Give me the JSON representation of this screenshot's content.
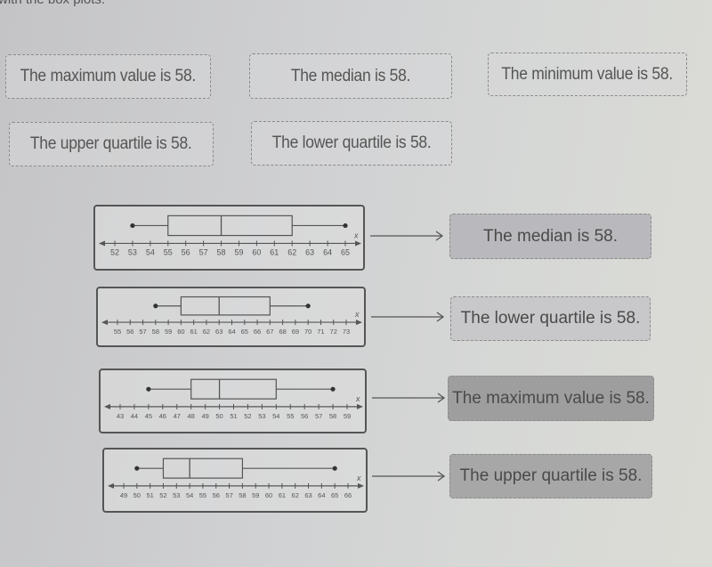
{
  "instruction": "with the box plots.",
  "tiles": [
    {
      "label": "The maximum value is 58."
    },
    {
      "label": "The median is 58."
    },
    {
      "label": "The minimum value is 58."
    },
    {
      "label": "The upper quartile is 58."
    },
    {
      "label": "The lower quartile is 58."
    }
  ],
  "pairs": [
    {
      "answer": "The median is 58.",
      "answer_bg": "#b9b9bd"
    },
    {
      "answer": "The lower quartile is 58.",
      "answer_bg": "#c8c8ca"
    },
    {
      "answer": "The maximum value is 58.",
      "answer_bg": "#9e9e9f"
    },
    {
      "answer": "The upper quartile is 58.",
      "answer_bg": "#a7a7a8"
    }
  ],
  "chart_data": [
    {
      "type": "box",
      "axis_label": "x",
      "ticks": [
        52,
        53,
        54,
        55,
        56,
        57,
        58,
        59,
        60,
        61,
        62,
        63,
        64,
        65
      ],
      "min": 53,
      "q1": 55,
      "median": 58,
      "q3": 62,
      "max": 65
    },
    {
      "type": "box",
      "axis_label": "x",
      "ticks": [
        55,
        56,
        57,
        58,
        59,
        60,
        61,
        62,
        63,
        64,
        65,
        66,
        67,
        68,
        69,
        70,
        71,
        72,
        73
      ],
      "min": 58,
      "q1": 60,
      "median": 63,
      "q3": 67,
      "max": 70
    },
    {
      "type": "box",
      "axis_label": "x",
      "ticks": [
        43,
        44,
        45,
        46,
        47,
        48,
        49,
        50,
        51,
        52,
        53,
        54,
        55,
        56,
        57,
        58,
        59
      ],
      "min": 45,
      "q1": 48,
      "median": 50,
      "q3": 54,
      "max": 58
    },
    {
      "type": "box",
      "axis_label": "x",
      "ticks": [
        49,
        50,
        51,
        52,
        53,
        54,
        55,
        56,
        57,
        58,
        59,
        60,
        61,
        62,
        63,
        64,
        65,
        66
      ],
      "min": 50,
      "q1": 52,
      "median": 54,
      "q3": 58,
      "max": 65
    }
  ]
}
